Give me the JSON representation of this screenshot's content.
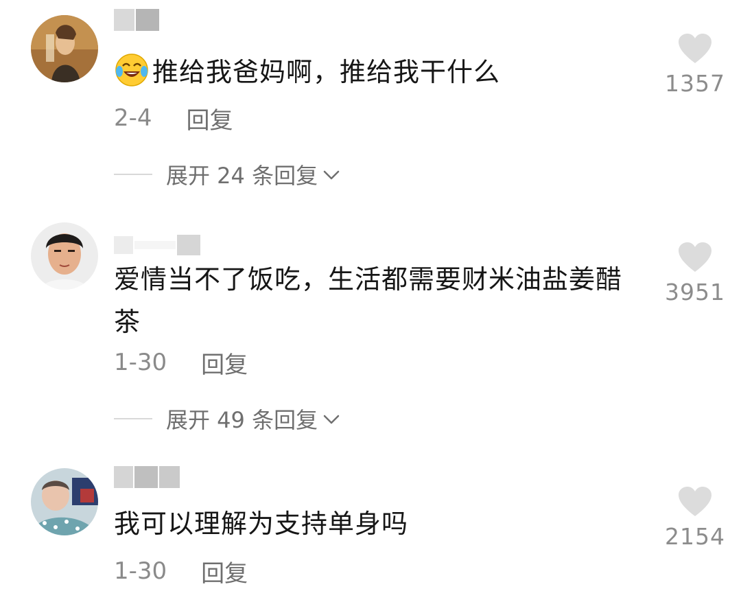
{
  "comments": [
    {
      "text": "推给我爸妈啊，推给我干什么",
      "date": "2-4",
      "reply_label": "回复",
      "expand_label": "展开 24 条回复",
      "likes": "1357",
      "emoji_icon": "crying-laughing-face-icon"
    },
    {
      "text": "爱情当不了饭吃，生活都需要财米油盐姜醋茶",
      "date": "1-30",
      "reply_label": "回复",
      "expand_label": "展开 49 条回复",
      "likes": "3951"
    },
    {
      "text": "我可以理解为支持单身吗",
      "date": "1-30",
      "reply_label": "回复",
      "likes": "2154"
    }
  ],
  "colors": {
    "text": "#161616",
    "meta": "#8a8a8a",
    "heart": "#dcdcdc",
    "divider": "#d8d8d8"
  },
  "icons": {
    "like": "heart-icon",
    "expand": "chevron-down-icon"
  }
}
